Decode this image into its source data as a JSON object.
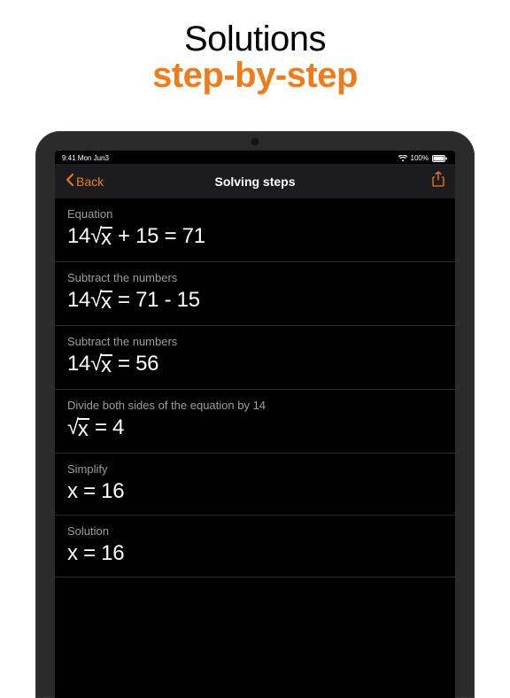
{
  "promo": {
    "line1": "Solutions",
    "line2": "step-by-step"
  },
  "statusbar": {
    "time": "9:41  Mon Jun3",
    "signal": "100%"
  },
  "navbar": {
    "back": "Back",
    "title": "Solving steps"
  },
  "steps": [
    {
      "label": "Equation",
      "prefix": "14",
      "sqrt": "x",
      "suffix": " + 15 = 71"
    },
    {
      "label": "Subtract the numbers",
      "prefix": "14",
      "sqrt": "x",
      "suffix": " = 71 - 15"
    },
    {
      "label": "Subtract the numbers",
      "prefix": "14",
      "sqrt": "x",
      "suffix": " = 56"
    },
    {
      "label": "Divide both sides of the equation by 14",
      "prefix": "",
      "sqrt": "x",
      "suffix": " = 4"
    },
    {
      "label": "Simplify",
      "plain": "x = 16"
    },
    {
      "label": "Solution",
      "plain": "x = 16"
    }
  ]
}
